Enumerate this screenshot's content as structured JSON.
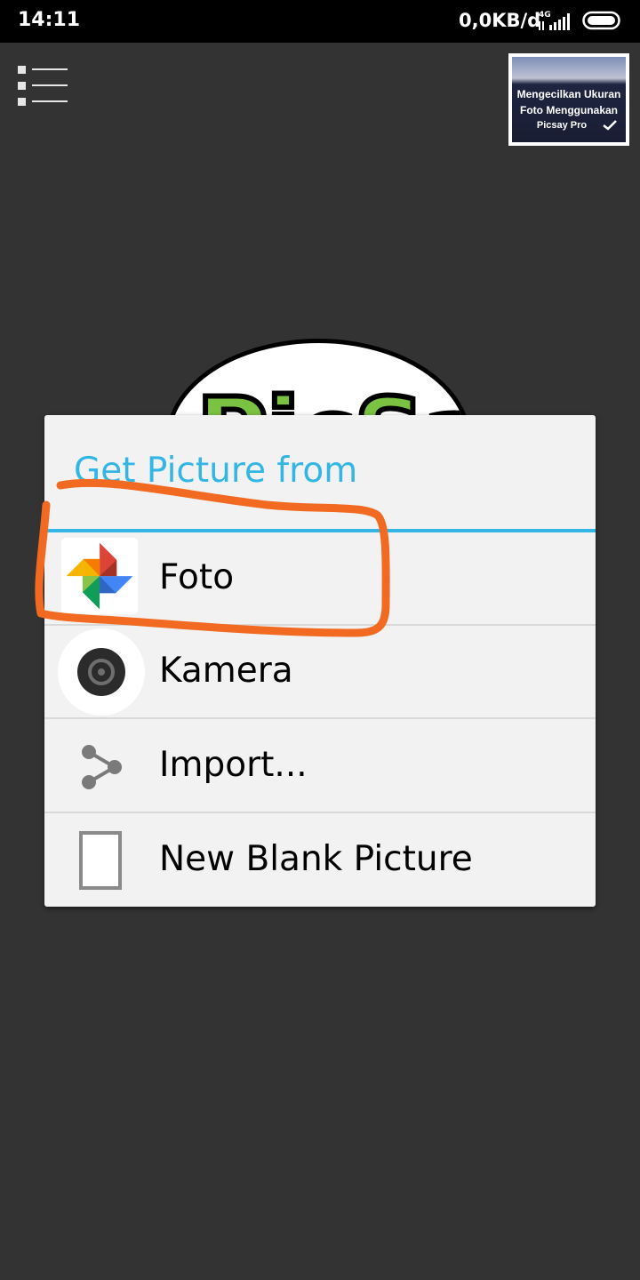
{
  "status_bar": {
    "time": "14:11",
    "network_speed": "0,0KB/d",
    "network_type": "4G",
    "icons": [
      "signal-icon",
      "battery-icon"
    ]
  },
  "toolbar": {
    "menu_icon": "menu-list-icon",
    "thumbnail": {
      "lines": [
        "Mengecilkan Ukuran",
        "Foto Menggunakan",
        "Picsay Pro"
      ],
      "icon": "checkmark-icon"
    }
  },
  "background_logo": {
    "text": "PicSay"
  },
  "dialog": {
    "title": "Get Picture from",
    "accent_color": "#33b5e5",
    "options": [
      {
        "label": "Foto",
        "icon": "google-photos-pinwheel-icon"
      },
      {
        "label": "Kamera",
        "icon": "camera-lens-icon"
      },
      {
        "label": "Import...",
        "icon": "share-icon"
      },
      {
        "label": "New Blank Picture",
        "icon": "blank-page-icon"
      }
    ]
  },
  "annotation": {
    "color": "#f26a21",
    "description_target": "Foto"
  },
  "colors": {
    "background": "#333333",
    "dialog_background": "#f2f2f2",
    "status_bar": "#000000"
  }
}
